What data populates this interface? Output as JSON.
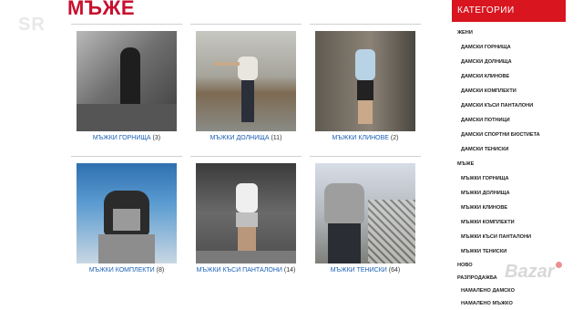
{
  "watermark": "SR",
  "page_title": "МЪЖЕ",
  "products": [
    {
      "label": "МЪЖКИ ГОРНИЩА",
      "count": "(3)"
    },
    {
      "label": "МЪЖКИ ДОЛНИЩА",
      "count": "(11)"
    },
    {
      "label": "МЪЖКИ КЛИНОВЕ",
      "count": "(2)"
    },
    {
      "label": "МЪЖКИ КОМПЛЕКТИ",
      "count": "(8)"
    },
    {
      "label": "МЪЖКИ КЪСИ ПАНТАЛОНИ",
      "count": "(14)"
    },
    {
      "label": "МЪЖКИ ТЕНИСКИ",
      "count": "(64)"
    }
  ],
  "sidebar": {
    "header": "КАТЕГОРИИ",
    "items": [
      {
        "label": "ЖЕНИ",
        "type": "group"
      },
      {
        "label": "ДАМСКИ ГОРНИЩА",
        "type": "sub"
      },
      {
        "label": "ДАМСКИ ДОЛНИЩА",
        "type": "sub"
      },
      {
        "label": "ДАМСКИ КЛИНОВЕ",
        "type": "sub"
      },
      {
        "label": "ДАМСКИ КОМПЛЕКТИ",
        "type": "sub"
      },
      {
        "label": "ДАМСКИ КЪСИ ПАНТАЛОНИ",
        "type": "sub"
      },
      {
        "label": "ДАМСКИ ПОТНИЦИ",
        "type": "sub"
      },
      {
        "label": "ДАМСКИ СПОРТНИ БЮСТИЕТА",
        "type": "sub"
      },
      {
        "label": "ДАМСКИ ТЕНИСКИ",
        "type": "sub"
      },
      {
        "label": "МЪЖЕ",
        "type": "group"
      },
      {
        "label": "МЪЖКИ ГОРНИЩА",
        "type": "sub"
      },
      {
        "label": "МЪЖКИ ДОЛНИЩА",
        "type": "sub"
      },
      {
        "label": "МЪЖКИ КЛИНОВЕ",
        "type": "sub"
      },
      {
        "label": "МЪЖКИ КОМПЛЕКТИ",
        "type": "sub"
      },
      {
        "label": "МЪЖКИ КЪСИ ПАНТАЛОНИ",
        "type": "sub"
      },
      {
        "label": "МЪЖКИ ТЕНИСКИ",
        "type": "sub"
      },
      {
        "label": "НОВО",
        "type": "group"
      },
      {
        "label": "РАЗПРОДАЖБА",
        "type": "group"
      },
      {
        "label": "НАМАЛЕНО ДАМСКО",
        "type": "sub"
      },
      {
        "label": "НАМАЛЕНО МЪЖКО",
        "type": "sub"
      }
    ]
  },
  "bazar_watermark": "Bazar",
  "colors": {
    "accent": "#d9151f",
    "title": "#c8102e",
    "link": "#1a5fb4"
  }
}
